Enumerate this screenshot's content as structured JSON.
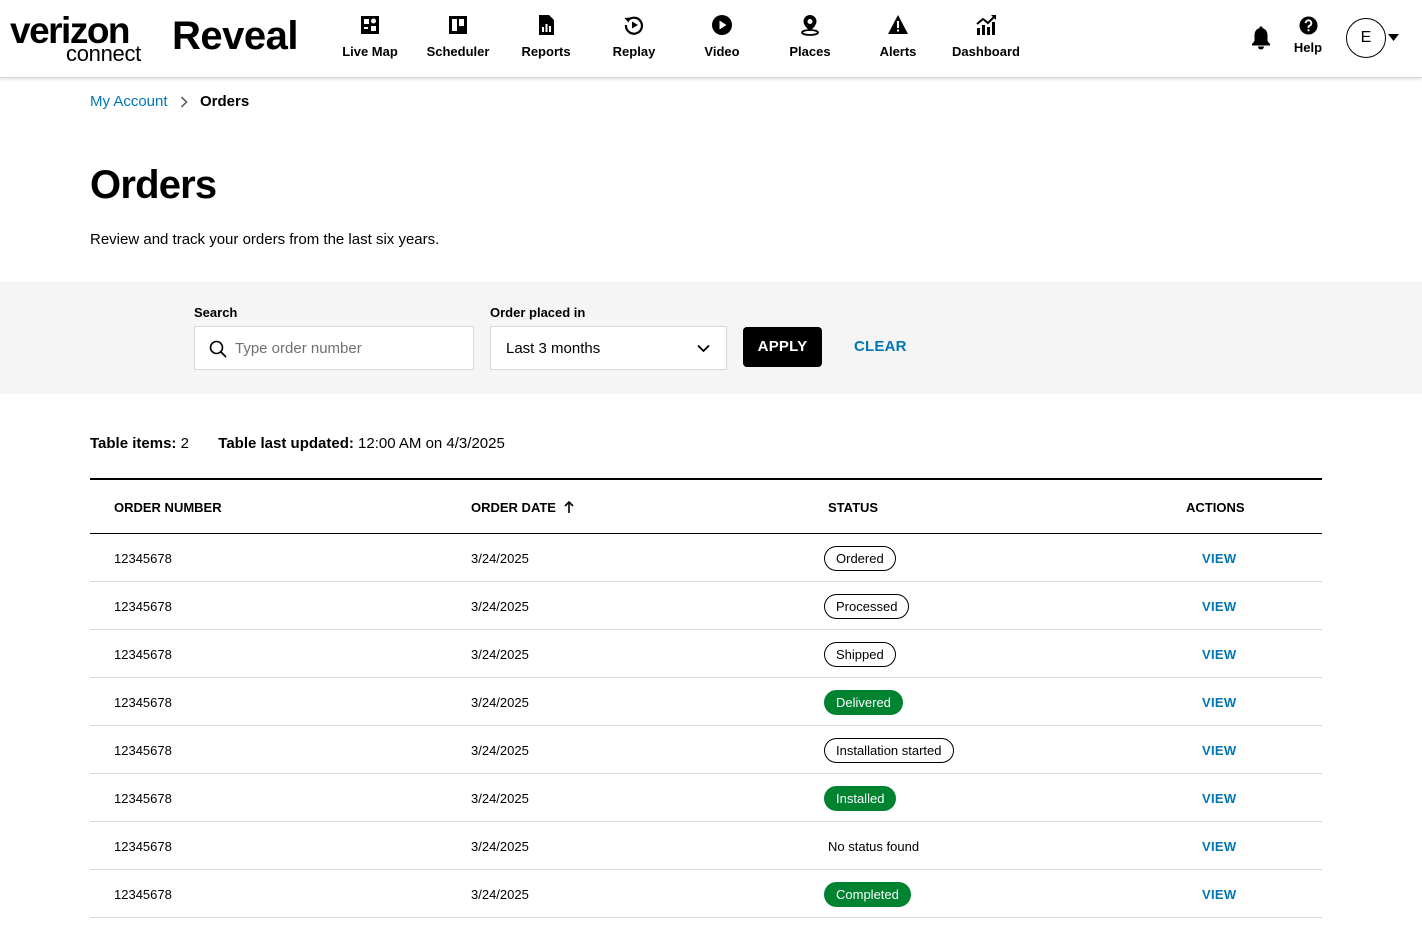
{
  "header": {
    "logo_word": "verizon",
    "logo_sub": "connect",
    "app_name": "Reveal",
    "nav": [
      {
        "label": "Live Map",
        "icon": "live-map-icon"
      },
      {
        "label": "Scheduler",
        "icon": "scheduler-icon"
      },
      {
        "label": "Reports",
        "icon": "reports-icon"
      },
      {
        "label": "Replay",
        "icon": "replay-icon"
      },
      {
        "label": "Video",
        "icon": "video-icon"
      },
      {
        "label": "Places",
        "icon": "places-icon"
      },
      {
        "label": "Alerts",
        "icon": "alerts-icon"
      },
      {
        "label": "Dashboard",
        "icon": "dashboard-icon"
      }
    ],
    "help_label": "Help",
    "avatar_initial": "E"
  },
  "breadcrumb": {
    "parent": "My Account",
    "current": "Orders"
  },
  "page": {
    "title": "Orders",
    "description": "Review and track your orders from the last six years."
  },
  "filters": {
    "search_label": "Search",
    "search_placeholder": "Type order number",
    "search_value": "",
    "period_label": "Order placed in",
    "period_value": "Last 3 months",
    "apply_label": "APPLY",
    "clear_label": "CLEAR"
  },
  "table_meta": {
    "items_label": "Table items:",
    "items_value": "2",
    "updated_label": "Table last updated:",
    "updated_value": "12:00 AM on 4/3/2025"
  },
  "table": {
    "columns": [
      "ORDER NUMBER",
      "ORDER DATE",
      "STATUS",
      "ACTIONS"
    ],
    "sort_column": "ORDER DATE",
    "sort_direction": "ascending",
    "action_label": "VIEW",
    "rows": [
      {
        "order_number": "12345678",
        "order_date": "3/24/2025",
        "status": "Ordered",
        "status_style": "outline"
      },
      {
        "order_number": "12345678",
        "order_date": "3/24/2025",
        "status": "Processed",
        "status_style": "outline"
      },
      {
        "order_number": "12345678",
        "order_date": "3/24/2025",
        "status": "Shipped",
        "status_style": "outline"
      },
      {
        "order_number": "12345678",
        "order_date": "3/24/2025",
        "status": "Delivered",
        "status_style": "green"
      },
      {
        "order_number": "12345678",
        "order_date": "3/24/2025",
        "status": "Installation started",
        "status_style": "outline"
      },
      {
        "order_number": "12345678",
        "order_date": "3/24/2025",
        "status": "Installed",
        "status_style": "green"
      },
      {
        "order_number": "12345678",
        "order_date": "3/24/2025",
        "status": "No status found",
        "status_style": "plain"
      },
      {
        "order_number": "12345678",
        "order_date": "3/24/2025",
        "status": "Completed",
        "status_style": "green"
      }
    ]
  },
  "colors": {
    "link_blue": "#0077b4",
    "status_green": "#008331",
    "filter_band": "#f5f5f5",
    "divider": "#d8dada"
  }
}
